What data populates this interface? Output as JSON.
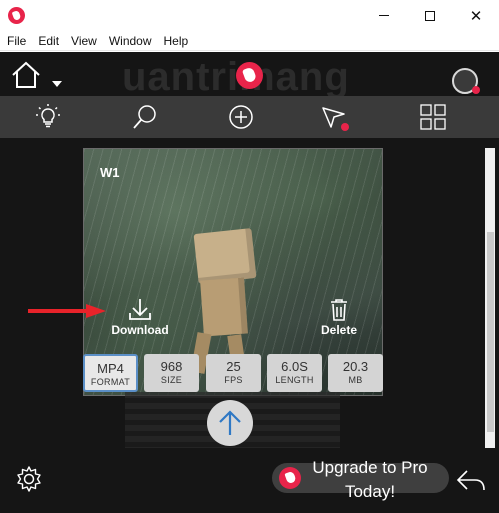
{
  "window": {
    "minimize_glyph": "",
    "close_glyph": "✕"
  },
  "menu": {
    "items": [
      "File",
      "Edit",
      "View",
      "Window",
      "Help"
    ]
  },
  "watermark": "uantrimang",
  "video": {
    "title": "W1",
    "download_label": "Download",
    "delete_label": "Delete",
    "info": [
      {
        "value": "MP4",
        "label": "FORMAT",
        "selected": true
      },
      {
        "value": "968",
        "label": "SIZE"
      },
      {
        "value": "25",
        "label": "FPS"
      },
      {
        "value": "6.0S",
        "label": "LENGTH"
      },
      {
        "value": "20.3",
        "label": "MB"
      }
    ]
  },
  "upgrade": {
    "line1": "Upgrade to Pro",
    "line2": "Today!"
  },
  "colors": {
    "accent": "#e8244a",
    "toolbar": "#3a3a3a",
    "background": "#151515",
    "selected_border": "#5b8fc7",
    "arrow": "#e8232a"
  },
  "icons": [
    "app-logo-icon",
    "home-icon",
    "chevron-down-icon",
    "brand-logo-icon",
    "profile-icon",
    "lightbulb-icon",
    "search-icon",
    "add-icon",
    "share-icon",
    "grid-icon",
    "download-icon",
    "trash-icon",
    "arrow-up-icon",
    "settings-icon",
    "back-icon"
  ]
}
